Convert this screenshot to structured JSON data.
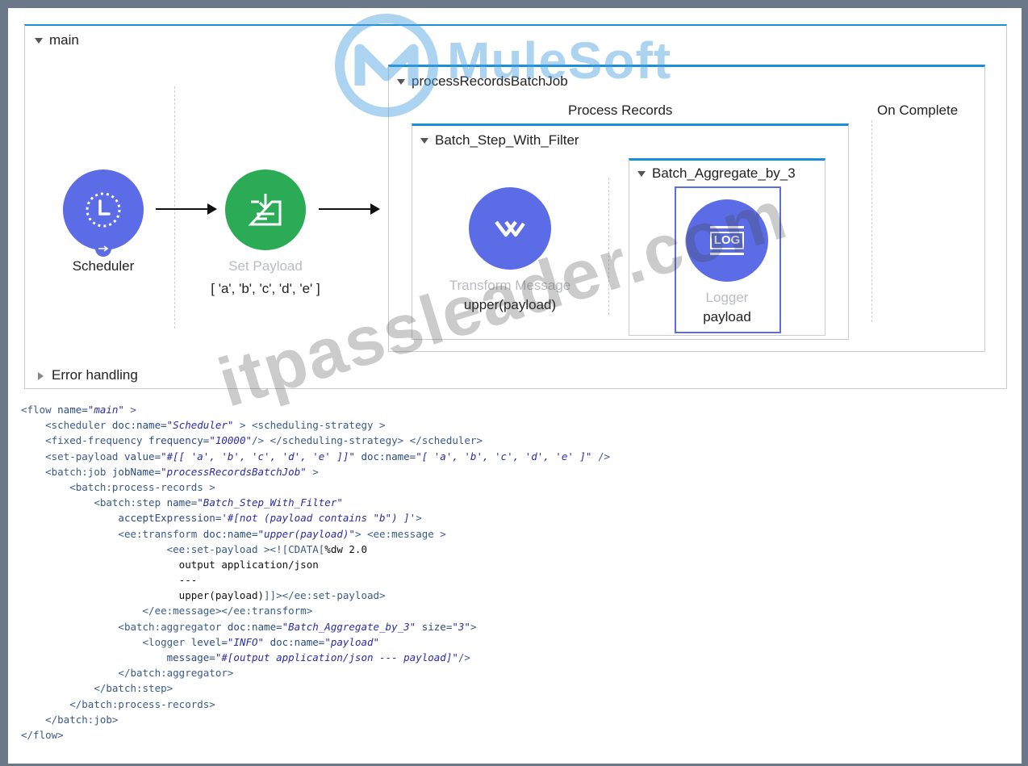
{
  "flow": {
    "main_label": "main",
    "error_handling_label": "Error handling"
  },
  "batch_job": {
    "title": "processRecordsBatchJob",
    "process_records_label": "Process Records",
    "on_complete_label": "On Complete",
    "step_title": "Batch_Step_With_Filter",
    "aggregator_title": "Batch_Aggregate_by_3"
  },
  "nodes": {
    "scheduler": {
      "name": "Scheduler",
      "color": "#5b6ce6"
    },
    "set_payload": {
      "type": "Set Payload",
      "name": "[ 'a', 'b', 'c', 'd', 'e' ]",
      "color": "#2bab55"
    },
    "transform": {
      "type": "Transform Message",
      "name": "upper(payload)",
      "color": "#5b6ce6"
    },
    "logger": {
      "type": "Logger",
      "name": "payload",
      "icon_text": "LOG",
      "color": "#5b6ce6"
    }
  },
  "code_lines": [
    {
      "indent": "",
      "parts": [
        [
          "tg",
          "<flow "
        ],
        [
          "at",
          "name="
        ],
        [
          "sv",
          "\"main\""
        ],
        [
          "tg",
          " >"
        ]
      ]
    },
    {
      "indent": "    ",
      "parts": [
        [
          "tg",
          "<scheduler "
        ],
        [
          "at",
          "doc:name="
        ],
        [
          "sv",
          "\"Scheduler\""
        ],
        [
          "tg",
          " > <scheduling-strategy >"
        ]
      ]
    },
    {
      "indent": "    ",
      "parts": [
        [
          "tg",
          "<fixed-frequency "
        ],
        [
          "at",
          "frequency="
        ],
        [
          "sv",
          "\"10000\""
        ],
        [
          "tg",
          "/> </scheduling-strategy> </scheduler>"
        ]
      ]
    },
    {
      "indent": "    ",
      "parts": [
        [
          "tg",
          "<set-payload "
        ],
        [
          "at",
          "value="
        ],
        [
          "sv",
          "\"#[[ 'a', 'b', 'c', 'd', 'e' ]]\""
        ],
        [
          "tg",
          " "
        ],
        [
          "at",
          "doc:name="
        ],
        [
          "sv",
          "\"[ 'a', 'b', 'c', 'd', 'e' ]\""
        ],
        [
          "tg",
          " />"
        ]
      ]
    },
    {
      "indent": "    ",
      "parts": [
        [
          "tg",
          "<batch:job "
        ],
        [
          "at",
          "jobName="
        ],
        [
          "sv",
          "\"processRecordsBatchJob\""
        ],
        [
          "tg",
          " >"
        ]
      ]
    },
    {
      "indent": "        ",
      "parts": [
        [
          "tg",
          "<batch:process-records >"
        ]
      ]
    },
    {
      "indent": "            ",
      "parts": [
        [
          "tg",
          "<batch:step "
        ],
        [
          "at",
          "name="
        ],
        [
          "sv",
          "\"Batch_Step_With_Filter\""
        ]
      ]
    },
    {
      "indent": "                ",
      "parts": [
        [
          "at",
          "acceptExpression="
        ],
        [
          "sv",
          "'#[not (payload contains \"b\") ]'"
        ],
        [
          "tg",
          ">"
        ]
      ]
    },
    {
      "indent": "                ",
      "parts": [
        [
          "tg",
          "<ee:transform "
        ],
        [
          "at",
          "doc:name="
        ],
        [
          "sv",
          "\"upper(payload)\""
        ],
        [
          "tg",
          "> <ee:message >"
        ]
      ]
    },
    {
      "indent": "                        ",
      "parts": [
        [
          "tg",
          "<ee:set-payload ><![CDATA["
        ],
        [
          "tx",
          "%dw 2.0"
        ]
      ]
    },
    {
      "indent": "                          ",
      "parts": [
        [
          "tx",
          "output application/json"
        ]
      ]
    },
    {
      "indent": "                          ",
      "parts": [
        [
          "tx",
          "---"
        ]
      ]
    },
    {
      "indent": "                          ",
      "parts": [
        [
          "tx",
          "upper(payload)"
        ],
        [
          "tg",
          "]]></ee:set-payload>"
        ]
      ]
    },
    {
      "indent": "                    ",
      "parts": [
        [
          "tg",
          "</ee:message></ee:transform>"
        ]
      ]
    },
    {
      "indent": "                ",
      "parts": [
        [
          "tg",
          "<batch:aggregator "
        ],
        [
          "at",
          "doc:name="
        ],
        [
          "sv",
          "\"Batch_Aggregate_by_3\""
        ],
        [
          "tg",
          " "
        ],
        [
          "at",
          "size="
        ],
        [
          "sv",
          "\"3\""
        ],
        [
          "tg",
          ">"
        ]
      ]
    },
    {
      "indent": "                    ",
      "parts": [
        [
          "tg",
          "<logger "
        ],
        [
          "at",
          "level="
        ],
        [
          "sv",
          "\"INFO\""
        ],
        [
          "tg",
          " "
        ],
        [
          "at",
          "doc:name="
        ],
        [
          "sv",
          "\"payload\""
        ]
      ]
    },
    {
      "indent": "                        ",
      "parts": [
        [
          "at",
          "message="
        ],
        [
          "sv",
          "\"#[output application/json --- payload]\""
        ],
        [
          "tg",
          "/>"
        ]
      ]
    },
    {
      "indent": "                ",
      "parts": [
        [
          "tg",
          "</batch:aggregator>"
        ]
      ]
    },
    {
      "indent": "            ",
      "parts": [
        [
          "tg",
          "</batch:step>"
        ]
      ]
    },
    {
      "indent": "        ",
      "parts": [
        [
          "tg",
          "</batch:process-records>"
        ]
      ]
    },
    {
      "indent": "    ",
      "parts": [
        [
          "tg",
          "</batch:job>"
        ]
      ]
    },
    {
      "indent": "",
      "parts": [
        [
          "tg",
          "</flow>"
        ]
      ]
    }
  ],
  "watermarks": {
    "logo_text": "MuleSoft",
    "site_text": "itpassleader.com"
  }
}
